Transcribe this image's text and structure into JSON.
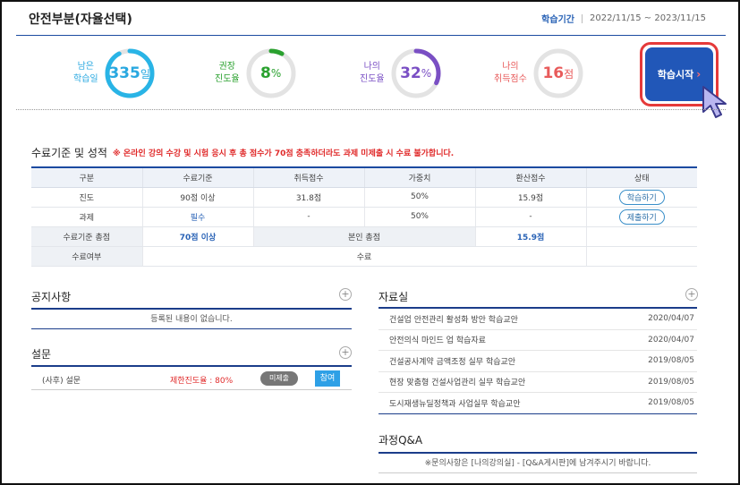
{
  "header": {
    "title": "안전부분(자율선택)",
    "period_label": "학습기간",
    "period_value": "2022/11/15 ~ 2023/11/15"
  },
  "stats": [
    {
      "label_1": "남은",
      "label_2": "학습일",
      "value": "335",
      "unit": "일",
      "progress": 0.92,
      "color": "#29b4e6",
      "label_color": "#29a8e0"
    },
    {
      "label_1": "권장",
      "label_2": "진도율",
      "value": "8",
      "unit": "%",
      "progress": 0.08,
      "color": "#2aa12f",
      "label_color": "#2aa12f"
    },
    {
      "label_1": "나의",
      "label_2": "진도율",
      "value": "32",
      "unit": "%",
      "progress": 0.32,
      "color": "#7a4fc4",
      "label_color": "#7a4fc4"
    },
    {
      "label_1": "나의",
      "label_2": "취득점수",
      "value": "16",
      "unit": "점",
      "progress": 0.0,
      "color": "#e85b5b",
      "label_color": "#e85b5b"
    }
  ],
  "start_button": {
    "label": "학습시작",
    "arrow": "›"
  },
  "criteria": {
    "title": "수료기준 및 성적",
    "note": "※ 온라인 강의 수강 및 시험 응시 후 총 점수가 70점 충족하더라도 과제 미제출 시 수료 불가합니다.",
    "headers": [
      "구분",
      "수료기준",
      "취득점수",
      "가중치",
      "환산점수",
      "상태"
    ],
    "rows": [
      {
        "type": "진도",
        "standard": "90점 이상",
        "score": "31.8점",
        "weight": "50%",
        "converted": "15.9점",
        "status": "학습하기"
      },
      {
        "type": "과제",
        "standard": "필수",
        "score": "-",
        "weight": "50%",
        "converted": "-",
        "status": "제출하기"
      }
    ],
    "total": {
      "label": "수료기준 총점",
      "standard": "70점 이상",
      "my_label": "본인 총점",
      "my_value": "15.9점"
    },
    "completion": {
      "label": "수료여부",
      "value": "수료"
    }
  },
  "notice": {
    "title": "공지사항",
    "empty": "등록된 내용이 없습니다."
  },
  "survey": {
    "title": "설문",
    "item": {
      "name": "(사후) 설문",
      "rate": "제한진도율 : 80%",
      "status": "미제출",
      "action": "참여"
    }
  },
  "resources": {
    "title": "자료실",
    "items": [
      {
        "title": "건설업 안전관리 활성화 방안 학습교안",
        "date": "2020/04/07"
      },
      {
        "title": "안전의식 마인드 업 학습자료",
        "date": "2020/04/07"
      },
      {
        "title": "건설공사계약 금액조정 실무 학습교안",
        "date": "2019/08/05"
      },
      {
        "title": "현장 맞춤형 건설사업관리 실무 학습교안",
        "date": "2019/08/05"
      },
      {
        "title": "도시재생뉴딜정책과 사업실무 학습교안",
        "date": "2019/08/05"
      }
    ]
  },
  "qa": {
    "title": "과정Q&A",
    "note": "※문의사항은 [나의강의실] - [Q&A게시판]에 남겨주시기 바랍니다."
  },
  "icons": {
    "plus": "plus-circle-icon",
    "cursor": "mouse-pointer-icon"
  }
}
